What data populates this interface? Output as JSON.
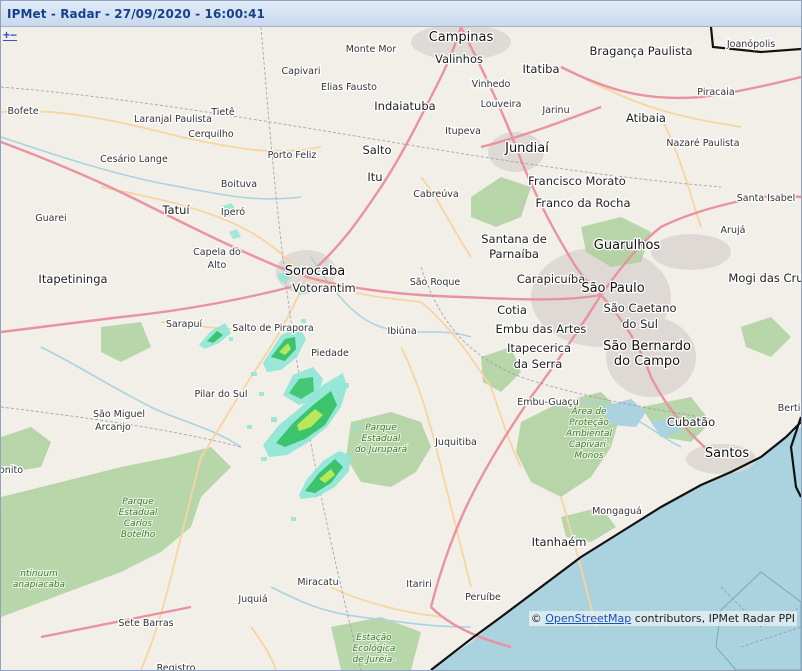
{
  "window": {
    "title": "IPMet - Radar - 27/09/2020 - 16:00:41"
  },
  "zoom": {
    "in_label": "+",
    "out_label": "−"
  },
  "attribution": {
    "prefix": "©",
    "link": "OpenStreetMap",
    "suffix": "contributors, IPMet Radar PPI"
  },
  "colors": {
    "land": "#f2efe9",
    "ocean": "#aad3df",
    "park": "#add19e",
    "primary_road": "#e892a2",
    "secondary_road": "#f7d4a0",
    "radar_light": "#8ee6d6",
    "radar_mid": "#3cc36e",
    "radar_core": "#b7e85a"
  },
  "map": {
    "places": [
      {
        "name": "Campinas",
        "cls": "major"
      },
      {
        "name": "Monte Mor",
        "cls": "town"
      },
      {
        "name": "Valinhos",
        "cls": "city"
      },
      {
        "name": "Vinhedo",
        "cls": "town"
      },
      {
        "name": "Itatiba",
        "cls": "city"
      },
      {
        "name": "Bragança Paulista",
        "cls": "city"
      },
      {
        "name": "Joanópolis",
        "cls": "town"
      },
      {
        "name": "Capivari",
        "cls": "town"
      },
      {
        "name": "Elias Fausto",
        "cls": "town"
      },
      {
        "name": "Indaiatuba",
        "cls": "city"
      },
      {
        "name": "Louveira",
        "cls": "town"
      },
      {
        "name": "Piracaia",
        "cls": "town"
      },
      {
        "name": "Laranjal Paulista",
        "cls": "town"
      },
      {
        "name": "Bofete",
        "cls": "town"
      },
      {
        "name": "Tietê",
        "cls": "town"
      },
      {
        "name": "Itupeva",
        "cls": "town"
      },
      {
        "name": "Jarinu",
        "cls": "town"
      },
      {
        "name": "Atibaia",
        "cls": "city"
      },
      {
        "name": "Cerquilho",
        "cls": "town"
      },
      {
        "name": "Nazaré Paulista",
        "cls": "town"
      },
      {
        "name": "Porto Feliz",
        "cls": "town"
      },
      {
        "name": "Salto",
        "cls": "city"
      },
      {
        "name": "Jundiaí",
        "cls": "major"
      },
      {
        "name": "Cesário Lange",
        "cls": "town"
      },
      {
        "name": "Itu",
        "cls": "city"
      },
      {
        "name": "Boituva",
        "cls": "town"
      },
      {
        "name": "Cabreúva",
        "cls": "town"
      },
      {
        "name": "Francisco Morato",
        "cls": "city"
      },
      {
        "name": "Tatuí",
        "cls": "city"
      },
      {
        "name": "Iperó",
        "cls": "town"
      },
      {
        "name": "Franco da Rocha",
        "cls": "city"
      },
      {
        "name": "Santa Isabel",
        "cls": "town"
      },
      {
        "name": "Guarei",
        "cls": "town"
      },
      {
        "name": "Arujá",
        "cls": "town"
      },
      {
        "name": "Santana de",
        "cls": "city"
      },
      {
        "name": "Guarulhos",
        "cls": "major"
      },
      {
        "name": "Capela do",
        "cls": "town"
      },
      {
        "name": "Parnaíba",
        "cls": "city"
      },
      {
        "name": "Sorocaba",
        "cls": "major"
      },
      {
        "name": "Alto",
        "cls": "town"
      },
      {
        "name": "Mogi das Cruz",
        "cls": "city"
      },
      {
        "name": "Votorantim",
        "cls": "city"
      },
      {
        "name": "São Roque",
        "cls": "town"
      },
      {
        "name": "Carapicuíba",
        "cls": "city"
      },
      {
        "name": "São Paulo",
        "cls": "major"
      },
      {
        "name": "Itapetininga",
        "cls": "city"
      },
      {
        "name": "São Caetano",
        "cls": "city"
      },
      {
        "name": "Sarapuí",
        "cls": "town"
      },
      {
        "name": "Salto de Pirapora",
        "cls": "town"
      },
      {
        "name": "Cotia",
        "cls": "city"
      },
      {
        "name": "do Sul",
        "cls": "city"
      },
      {
        "name": "Ibiúna",
        "cls": "town"
      },
      {
        "name": "Embu das Artes",
        "cls": "city"
      },
      {
        "name": "Piedade",
        "cls": "town"
      },
      {
        "name": "São Bernardo",
        "cls": "major"
      },
      {
        "name": "Itapecerica",
        "cls": "city"
      },
      {
        "name": "do Campo",
        "cls": "major"
      },
      {
        "name": "da Serra",
        "cls": "city"
      },
      {
        "name": "Pilar do Sul",
        "cls": "town"
      },
      {
        "name": "Embu-Guaçu",
        "cls": "town"
      },
      {
        "name": "São Miguel",
        "cls": "town"
      },
      {
        "name": "Arcanjo",
        "cls": "town"
      },
      {
        "name": "Bertio",
        "cls": "town"
      },
      {
        "name": "Cubatão",
        "cls": "city"
      },
      {
        "name": "Juquitiba",
        "cls": "town"
      },
      {
        "name": "Santos",
        "cls": "major"
      },
      {
        "name": "onito",
        "cls": "town"
      },
      {
        "name": "Mongaguá",
        "cls": "town"
      },
      {
        "name": "Itanhaém",
        "cls": "city"
      },
      {
        "name": "Miracatu",
        "cls": "town"
      },
      {
        "name": "Itariri",
        "cls": "town"
      },
      {
        "name": "Juquiá",
        "cls": "town"
      },
      {
        "name": "Peruíbe",
        "cls": "town"
      },
      {
        "name": "Sete Barras",
        "cls": "town"
      },
      {
        "name": "Registro",
        "cls": "town"
      }
    ],
    "protected_areas": [
      {
        "lines": [
          "Parque",
          "Estadual",
          "Carlos",
          "Botelho"
        ]
      },
      {
        "lines": [
          "Parque",
          "Estadual",
          "do Jurupará"
        ]
      },
      {
        "lines": [
          "Área de",
          "Proteção",
          "Ambiental",
          "Capivari-",
          "Monos"
        ]
      },
      {
        "lines": [
          "Estação",
          "Ecológica",
          "de Juréia-"
        ]
      },
      {
        "lines": [
          "ntinuum",
          "anapiacaba"
        ]
      }
    ]
  }
}
